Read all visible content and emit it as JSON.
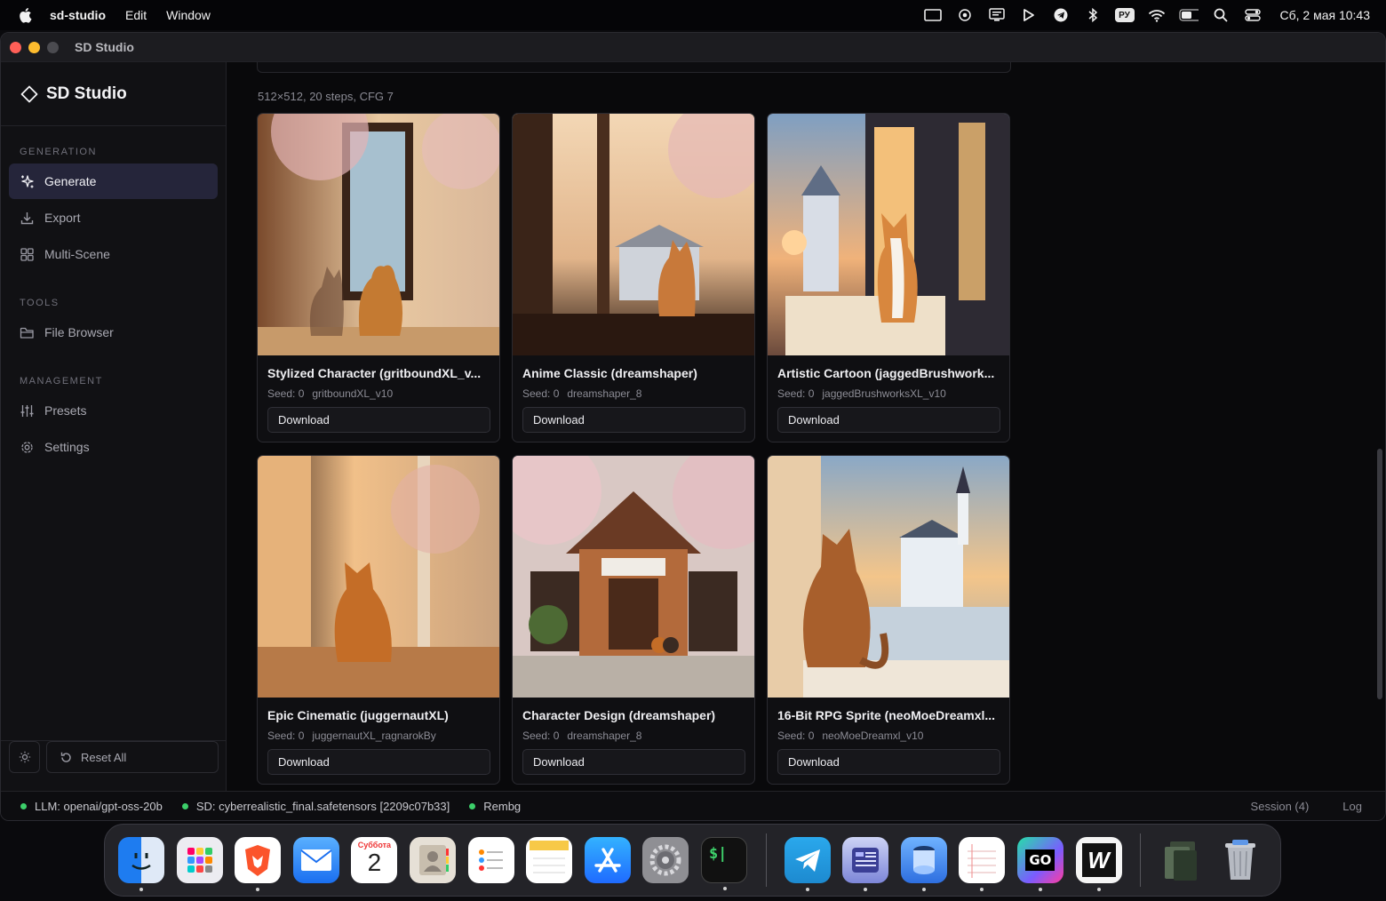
{
  "menubar": {
    "app_name": "sd-studio",
    "menus": [
      "Edit",
      "Window"
    ],
    "keyboard_layout": "РУ",
    "datetime": "Сб, 2 мая  10:43"
  },
  "window": {
    "title": "SD Studio"
  },
  "sidebar": {
    "brand": "SD Studio",
    "sections": [
      {
        "label": "GENERATION",
        "items": [
          {
            "label": "Generate",
            "icon": "sparkles-icon",
            "active": true
          },
          {
            "label": "Export",
            "icon": "download-icon"
          },
          {
            "label": "Multi-Scene",
            "icon": "grid-icon"
          }
        ]
      },
      {
        "label": "TOOLS",
        "items": [
          {
            "label": "File Browser",
            "icon": "folder-icon"
          }
        ]
      },
      {
        "label": "MANAGEMENT",
        "items": [
          {
            "label": "Presets",
            "icon": "sliders-icon"
          },
          {
            "label": "Settings",
            "icon": "gear-icon"
          }
        ]
      }
    ],
    "reset_label": "Reset All"
  },
  "main": {
    "run_meta": "512×512, 20 steps, CFG 7",
    "cards": [
      {
        "title": "Stylized Character (gritboundXL_v...",
        "seed": "Seed: 0",
        "model": "gritboundXL_v10",
        "button": "Download"
      },
      {
        "title": "Anime Classic (dreamshaper)",
        "seed": "Seed: 0",
        "model": "dreamshaper_8",
        "button": "Download"
      },
      {
        "title": "Artistic Cartoon (jaggedBrushwork...",
        "seed": "Seed: 0",
        "model": "jaggedBrushworksXL_v10",
        "button": "Download"
      },
      {
        "title": "Epic Cinematic (juggernautXL)",
        "seed": "Seed: 0",
        "model": "juggernautXL_ragnarokBy",
        "button": "Download"
      },
      {
        "title": "Character Design (dreamshaper)",
        "seed": "Seed: 0",
        "model": "dreamshaper_8",
        "button": "Download"
      },
      {
        "title": "16-Bit RPG Sprite (neoMoeDreamxl...",
        "seed": "Seed: 0",
        "model": "neoMoeDreamxl_v10",
        "button": "Download"
      }
    ]
  },
  "statusbar": {
    "llm": "LLM: openai/gpt-oss-20b",
    "sd": "SD: cyberrealistic_final.safetensors [2209c07b33]",
    "rembg": "Rembg",
    "session": "Session (4)",
    "log": "Log"
  },
  "dock": {
    "calendar_day": "Суббота",
    "calendar_date": "2",
    "terminal_glyph": "$|",
    "goland_label": "GO",
    "webstorm_label": "W"
  }
}
